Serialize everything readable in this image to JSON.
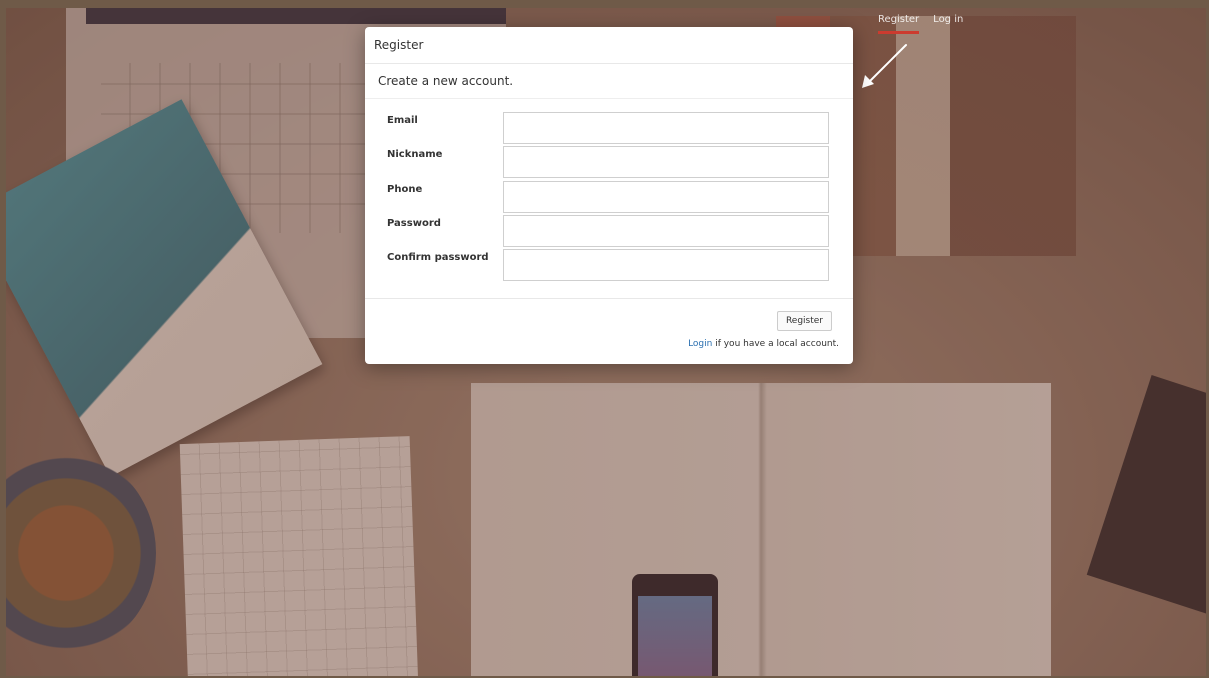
{
  "nav": {
    "register_label": "Register",
    "login_label": "Log in",
    "active_color": "#cc3b2f"
  },
  "modal": {
    "title": "Register",
    "subtitle": "Create a new account.",
    "fields": [
      {
        "label": "Email",
        "value": "",
        "placeholder": ""
      },
      {
        "label": "Nickname",
        "value": "",
        "placeholder": ""
      },
      {
        "label": "Phone",
        "value": "",
        "placeholder": ""
      },
      {
        "label": "Password",
        "value": "",
        "placeholder": ""
      },
      {
        "label": "Confirm password",
        "value": "",
        "placeholder": ""
      }
    ],
    "submit_label": "Register",
    "login_link": "Login",
    "login_suffix": " if you have a local account.",
    "link_color": "#2a6fb0"
  },
  "annotation": {
    "arrow_icon": "arrow-pointer-icon",
    "arrow_color": "#ffffff"
  }
}
